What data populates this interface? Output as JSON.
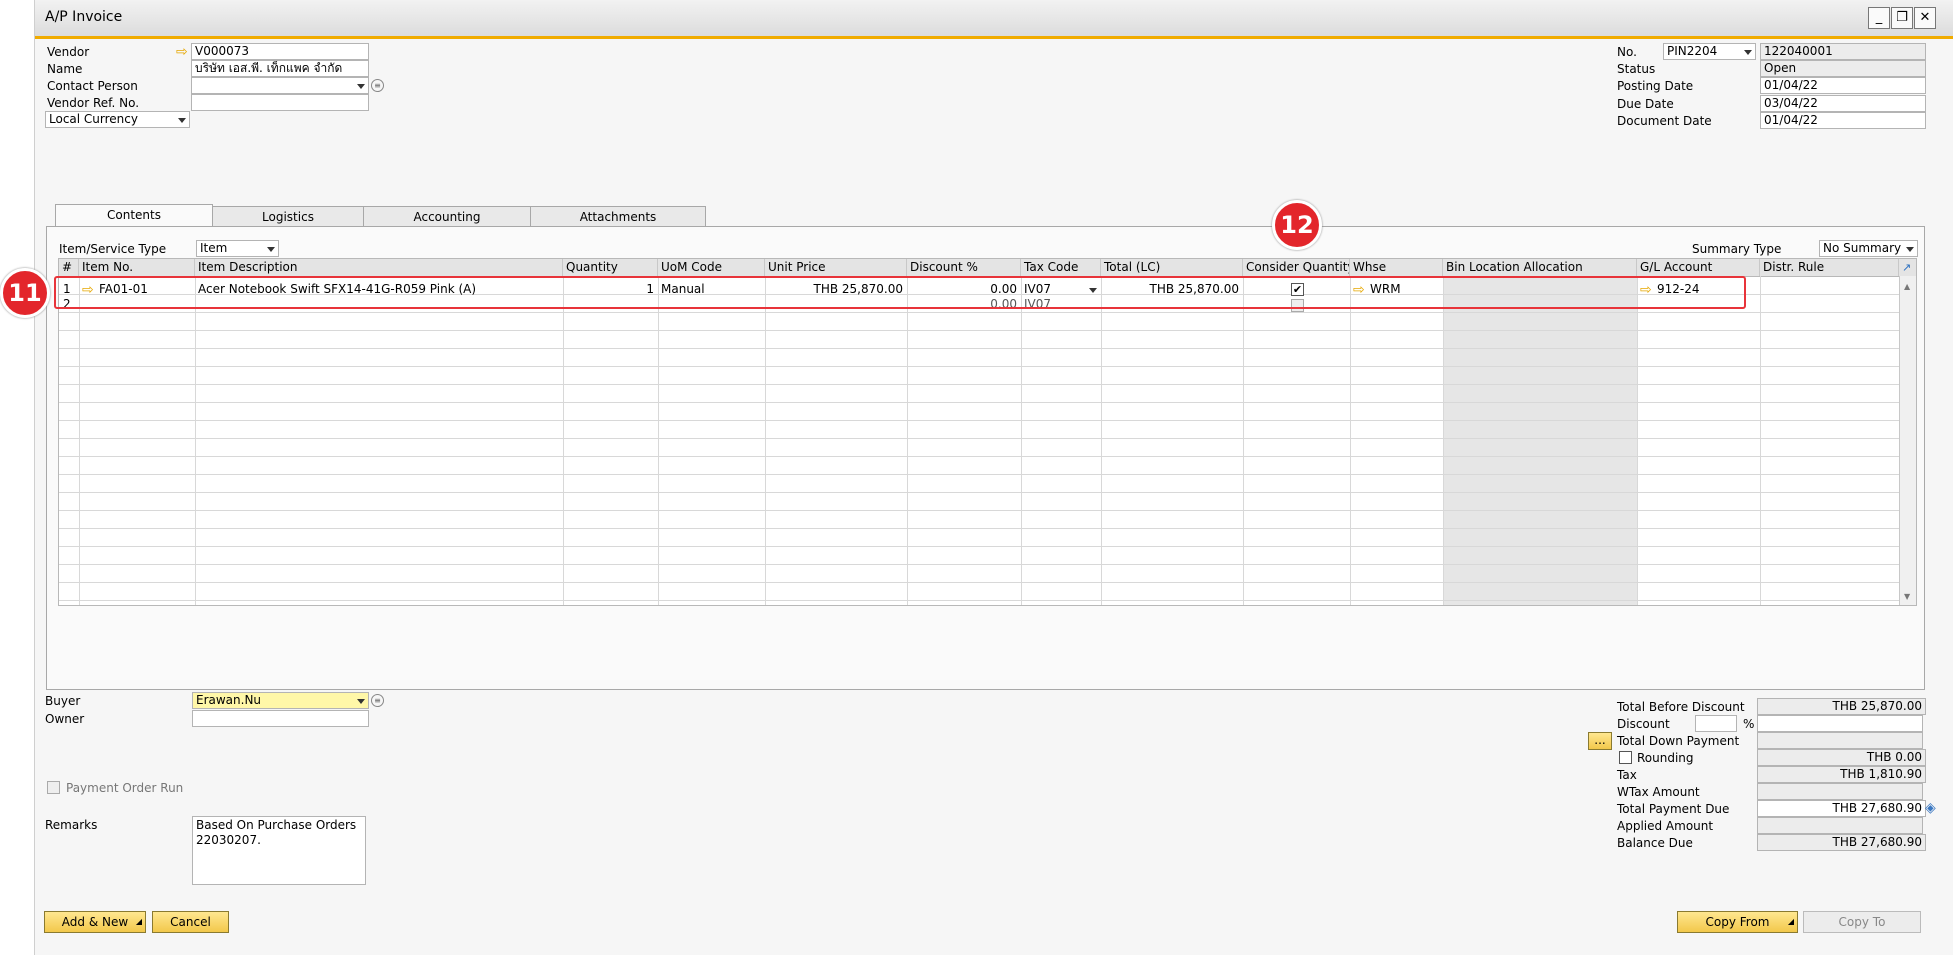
{
  "window": {
    "title": "A/P Invoice"
  },
  "header_left": {
    "vendor_label": "Vendor",
    "vendor_value": "V000073",
    "name_label": "Name",
    "name_value": "บริษัท เอส.พี. เท็กแพค จำกัด",
    "contact_label": "Contact Person",
    "vendor_ref_label": "Vendor Ref. No.",
    "currency_label": "Local Currency"
  },
  "header_right": {
    "no_label": "No.",
    "series": "PIN2204",
    "number": "122040001",
    "status_label": "Status",
    "status_value": "Open",
    "posting_label": "Posting Date",
    "posting_value": "01/04/22",
    "due_label": "Due Date",
    "due_value": "03/04/22",
    "document_label": "Document Date",
    "document_value": "01/04/22"
  },
  "tabs": [
    "Contents",
    "Logistics",
    "Accounting",
    "Attachments"
  ],
  "contents": {
    "item_type_label": "Item/Service Type",
    "item_type_value": "Item",
    "summary_label": "Summary Type",
    "summary_value": "No Summary"
  },
  "grid": {
    "columns": [
      "#",
      "Item No.",
      "Item Description",
      "Quantity",
      "UoM Code",
      "Unit Price",
      "Discount %",
      "Tax Code",
      "Total (LC)",
      "Consider Quantity",
      "Whse",
      "Bin Location Allocation",
      "G/L Account",
      "Distr. Rule"
    ],
    "rows": [
      {
        "num": "1",
        "item_no": "FA01-01",
        "description": "Acer Notebook Swift SFX14-41G-R059 Pink (A)",
        "quantity": "1",
        "uom": "Manual",
        "unit_price": "THB 25,870.00",
        "discount": "0.00",
        "tax_code": "IV07",
        "total": "THB 25,870.00",
        "consider_qty": true,
        "whse": "WRM",
        "gl_account": "912-24"
      },
      {
        "num": "2",
        "discount": "0.00",
        "tax_code": "IV07",
        "consider_qty": false
      }
    ]
  },
  "badges": {
    "left": "11",
    "top": "12"
  },
  "footer_left": {
    "buyer_label": "Buyer",
    "buyer_value": "Erawan.Nu",
    "owner_label": "Owner",
    "payment_order_label": "Payment Order Run",
    "remarks_label": "Remarks",
    "remarks_line1": "Based On Purchase Orders",
    "remarks_line2": "22030207."
  },
  "totals": {
    "before_discount_label": "Total Before Discount",
    "before_discount_value": "THB 25,870.00",
    "discount_label": "Discount",
    "discount_pct": "%",
    "down_payment_label": "Total Down Payment",
    "rounding_label": "Rounding",
    "rounding_value": "THB 0.00",
    "tax_label": "Tax",
    "tax_value": "THB 1,810.90",
    "wtax_label": "WTax Amount",
    "payment_due_label": "Total Payment Due",
    "payment_due_value": "THB 27,680.90",
    "applied_label": "Applied Amount",
    "balance_label": "Balance Due",
    "balance_value": "THB 27,680.90"
  },
  "buttons": {
    "add_new": "Add & New",
    "cancel": "Cancel",
    "copy_from": "Copy From",
    "copy_to": "Copy To",
    "ellipsis": "..."
  }
}
